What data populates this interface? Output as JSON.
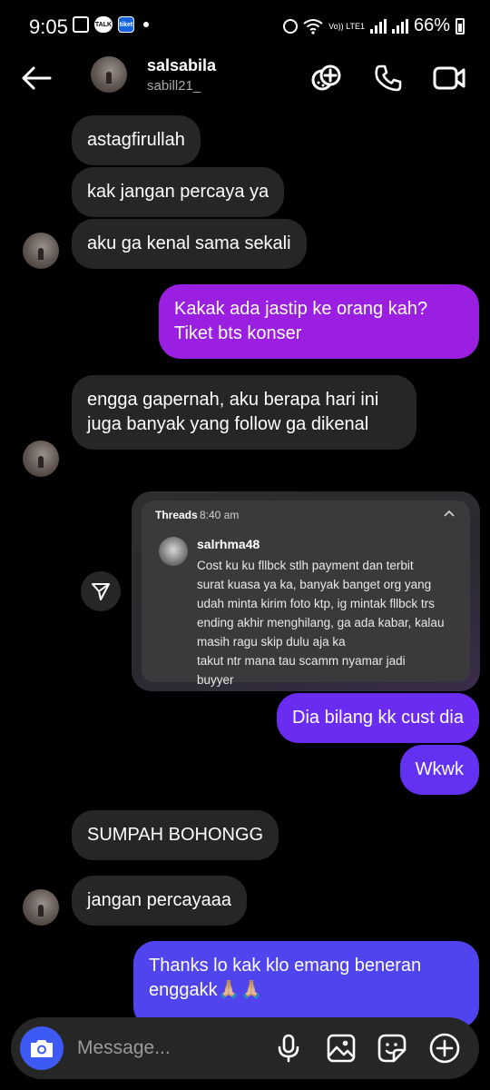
{
  "status_bar": {
    "time": "9:05",
    "notif_talk": "TALK",
    "notif_tiket": "tiket",
    "network": "Vo)) LTE1",
    "battery": "66%"
  },
  "header": {
    "name": "salsabila",
    "username": "sabill21_"
  },
  "messages": [
    {
      "from": "them",
      "text": "astagfirullah"
    },
    {
      "from": "them",
      "text": "kak jangan percaya ya"
    },
    {
      "from": "them",
      "text": "aku ga kenal sama sekali"
    },
    {
      "from": "me",
      "text": "Kakak ada jastip ke orang kah? Tiket bts konser"
    },
    {
      "from": "them",
      "text": "engga gapernah, aku berapa hari ini juga banyak yang follow ga dikenal"
    },
    {
      "from": "me",
      "text": "Dia bilang kk cust dia"
    },
    {
      "from": "me",
      "text": "Wkwk"
    },
    {
      "from": "them",
      "text": "SUMPAH BOHONGG"
    },
    {
      "from": "them",
      "text": "jangan percayaaa"
    },
    {
      "from": "me",
      "text": "Thanks lo kak klo emang beneran enggakk🙏🏼🙏🏼"
    }
  ],
  "shared_post": {
    "app": "Threads",
    "time": "8:40 am",
    "username": "salrhma48",
    "text_lines": [
      "Cost ku ku fllbck stlh payment dan terbit",
      "surat kuasa ya ka, banyak banget org yang",
      "udah minta kirim foto ktp, ig mintak fllbck trs",
      "ending akhir menghilang, ga ada kabar, kalau",
      "masih ragu skip dulu aja ka",
      "takut ntr mana tau scamm nyamar jadi",
      "buyyer"
    ]
  },
  "composer": {
    "placeholder": "Message..."
  },
  "colors": {
    "incoming_bubble": "#262626",
    "outgoing_purple": "#9b1fe0",
    "outgoing_violet": "#6a2cf0",
    "outgoing_indigo": "#4f44ee",
    "camera_button": "#3d5af5"
  }
}
